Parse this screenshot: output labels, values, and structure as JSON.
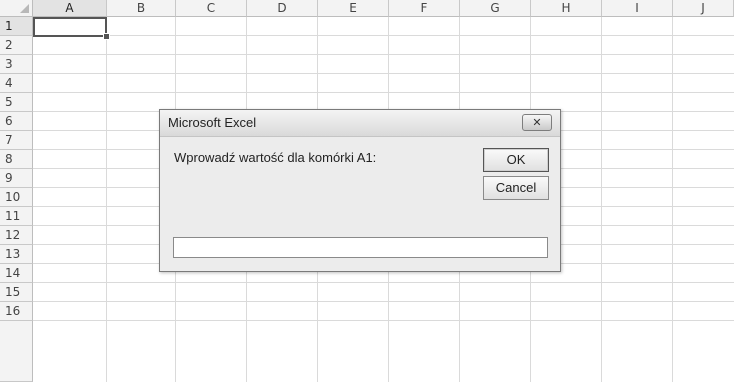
{
  "spreadsheet": {
    "columns": [
      "A",
      "B",
      "C",
      "D",
      "E",
      "F",
      "G",
      "H",
      "I",
      "J"
    ],
    "rows": [
      "1",
      "2",
      "3",
      "4",
      "5",
      "6",
      "7",
      "8",
      "9",
      "10",
      "11",
      "12",
      "13",
      "14",
      "15",
      "16"
    ],
    "active_cell": "A1"
  },
  "dialog": {
    "title": "Microsoft Excel",
    "close_label": "✕",
    "prompt": "Wprowadź wartość dla komórki A1:",
    "ok_label": "OK",
    "cancel_label": "Cancel",
    "input_value": ""
  }
}
